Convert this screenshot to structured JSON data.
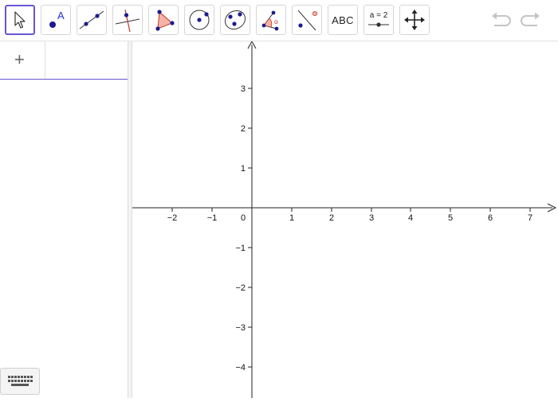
{
  "toolbar": {
    "tools": [
      {
        "name": "Move",
        "icon": "cursor-arrow-icon"
      },
      {
        "name": "Point",
        "icon": "point-icon",
        "label": "A"
      },
      {
        "name": "Line",
        "icon": "line-through-two-points-icon"
      },
      {
        "name": "Perpendicular Line",
        "icon": "perpendicular-line-icon"
      },
      {
        "name": "Polygon",
        "icon": "polygon-icon"
      },
      {
        "name": "Circle with Center through Point",
        "icon": "circle-center-point-icon"
      },
      {
        "name": "Conic through 5 Points",
        "icon": "ellipse-icon"
      },
      {
        "name": "Angle",
        "icon": "angle-icon",
        "label": "α"
      },
      {
        "name": "Reflect about Line",
        "icon": "reflect-icon"
      },
      {
        "name": "Text",
        "icon": "text-icon",
        "label": "ABC"
      },
      {
        "name": "Slider",
        "icon": "slider-icon",
        "label": "a = 2"
      },
      {
        "name": "Move Graphics View",
        "icon": "move-graphics-icon"
      }
    ],
    "undo_icon": "undo-icon",
    "redo_icon": "redo-icon"
  },
  "algebra": {
    "input_icon": "plus-icon",
    "input_symbol": "+"
  },
  "graphics": {
    "x_ticks": [
      "−2",
      "−1",
      "1",
      "2",
      "3",
      "4",
      "5",
      "6",
      "7"
    ],
    "y_ticks": [
      "3",
      "2",
      "1",
      "−1",
      "−2",
      "−3",
      "−4"
    ],
    "origin_label": "0"
  },
  "keyboard_icon": "keyboard-icon",
  "colors": {
    "accent": "#6557d2",
    "point": "#1c1c8f",
    "polygon_fill": "#f4b3a6",
    "polygon_stroke": "#c0392b"
  }
}
